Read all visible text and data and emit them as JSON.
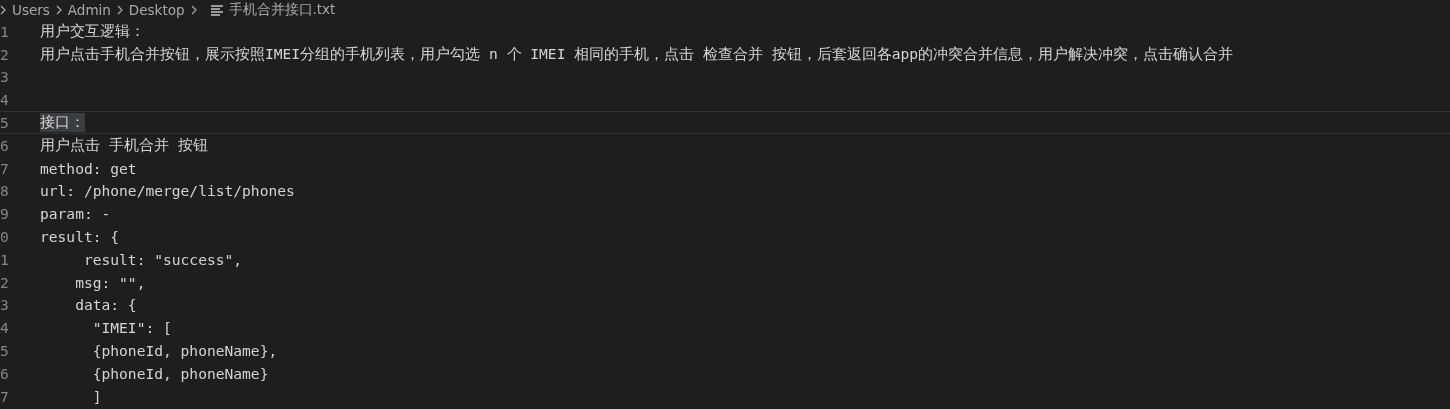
{
  "breadcrumb": {
    "folders": [
      "Users",
      "Admin",
      "Desktop"
    ],
    "file": "手机合并接口.txt"
  },
  "editor": {
    "lines": [
      {
        "number": "1",
        "text": "用户交互逻辑："
      },
      {
        "number": "2",
        "text": "用户点击手机合并按钮，展示按照IMEI分组的手机列表，用户勾选 n 个 IMEI 相同的手机，点击 检查合并 按钮，后套返回各app的冲突合并信息，用户解决冲突，点击确认合并"
      },
      {
        "number": "3"
      },
      {
        "number": "4"
      },
      {
        "number": "5",
        "text": "接口：",
        "current": true,
        "selected": true
      },
      {
        "number": "6",
        "text": "用户点击 手机合并 按钮"
      },
      {
        "number": "7",
        "text": "method: get"
      },
      {
        "number": "8",
        "text": "url: /phone/merge/list/phones"
      },
      {
        "number": "9",
        "text": "param: -"
      },
      {
        "number": "0",
        "text": "result: {"
      },
      {
        "number": "1",
        "text": "     result: \"success\","
      },
      {
        "number": "2",
        "text": "    msg: \"\","
      },
      {
        "number": "3",
        "text": "    data: {"
      },
      {
        "number": "4",
        "text": "      \"IMEI\": ["
      },
      {
        "number": "5",
        "text": "      {phoneId, phoneName},"
      },
      {
        "number": "6",
        "text": "      {phoneId, phoneName}"
      },
      {
        "number": "7",
        "text": "      ]"
      }
    ]
  }
}
